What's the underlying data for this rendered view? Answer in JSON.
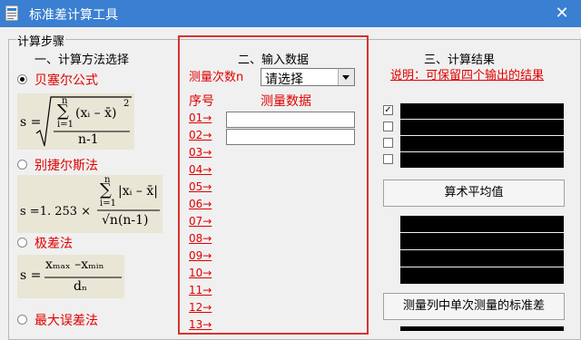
{
  "window": {
    "title": "标准差计算工具",
    "close_glyph": "✕"
  },
  "steps_group": {
    "title": "计算步骤"
  },
  "section1": {
    "title": "一、计算方法选择",
    "options": [
      {
        "label": "贝塞尔公式",
        "selected": true
      },
      {
        "label": "别捷尔斯法",
        "selected": false
      },
      {
        "label": "极差法",
        "selected": false
      },
      {
        "label": "最大误差法",
        "selected": false
      }
    ]
  },
  "formulas": {
    "bessel": {
      "lhs": "s =",
      "sum_top": "n",
      "sum_bottom": "i=1",
      "term": "(xᵢ – x̄)",
      "power": "2",
      "denom": "n-1"
    },
    "peters": {
      "lhs": "s =1. 253 ×",
      "sum_top": "n",
      "sum_bottom": "i=1",
      "term": "|xᵢ – x̄|",
      "denom": "√n(n-1)"
    },
    "range": {
      "lhs": "s =",
      "numer": "xₘₐₓ –xₘᵢₙ",
      "denom": "dₙ"
    }
  },
  "section2": {
    "title": "二、输入数据",
    "count_label": "测量次数n",
    "count_select": "请选择",
    "col_index": "序号",
    "col_data": "测量数据",
    "rows": [
      "01→",
      "02→",
      "03→",
      "04→",
      "05→",
      "06→",
      "07→",
      "08→",
      "09→",
      "10→",
      "11→",
      "12→",
      "13→"
    ]
  },
  "section3": {
    "title": "三、计算结果",
    "note": "说明：可保留四个输出的结果",
    "mean_button": "算术平均值",
    "std_button": "测量列中单次测量的标准差",
    "checks": [
      true,
      false,
      false,
      false
    ]
  }
}
